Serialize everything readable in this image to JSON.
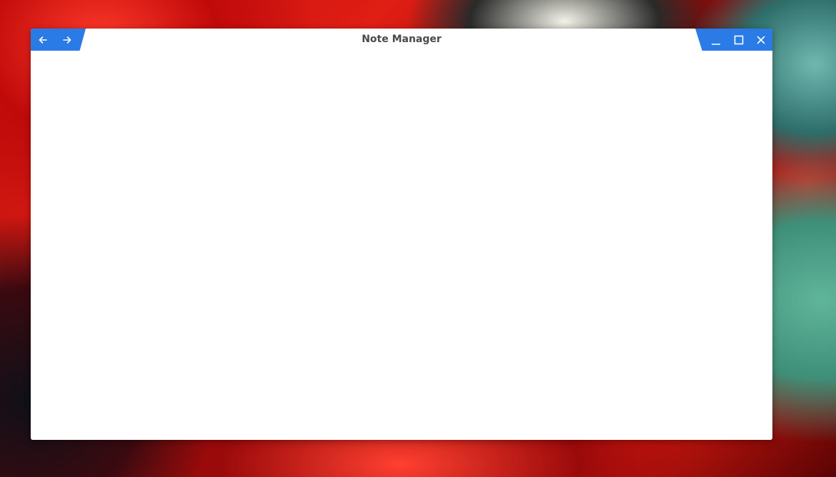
{
  "window": {
    "title": "Note Manager",
    "accent_color": "#2b7be6"
  },
  "titlebar": {
    "nav": [
      {
        "name": "back-button",
        "icon": "arrow-left-icon"
      },
      {
        "name": "forward-button",
        "icon": "arrow-right-icon"
      }
    ],
    "controls": [
      {
        "name": "minimize-button",
        "icon": "minimize-icon"
      },
      {
        "name": "maximize-button",
        "icon": "maximize-icon"
      },
      {
        "name": "close-button",
        "icon": "close-icon"
      }
    ]
  }
}
